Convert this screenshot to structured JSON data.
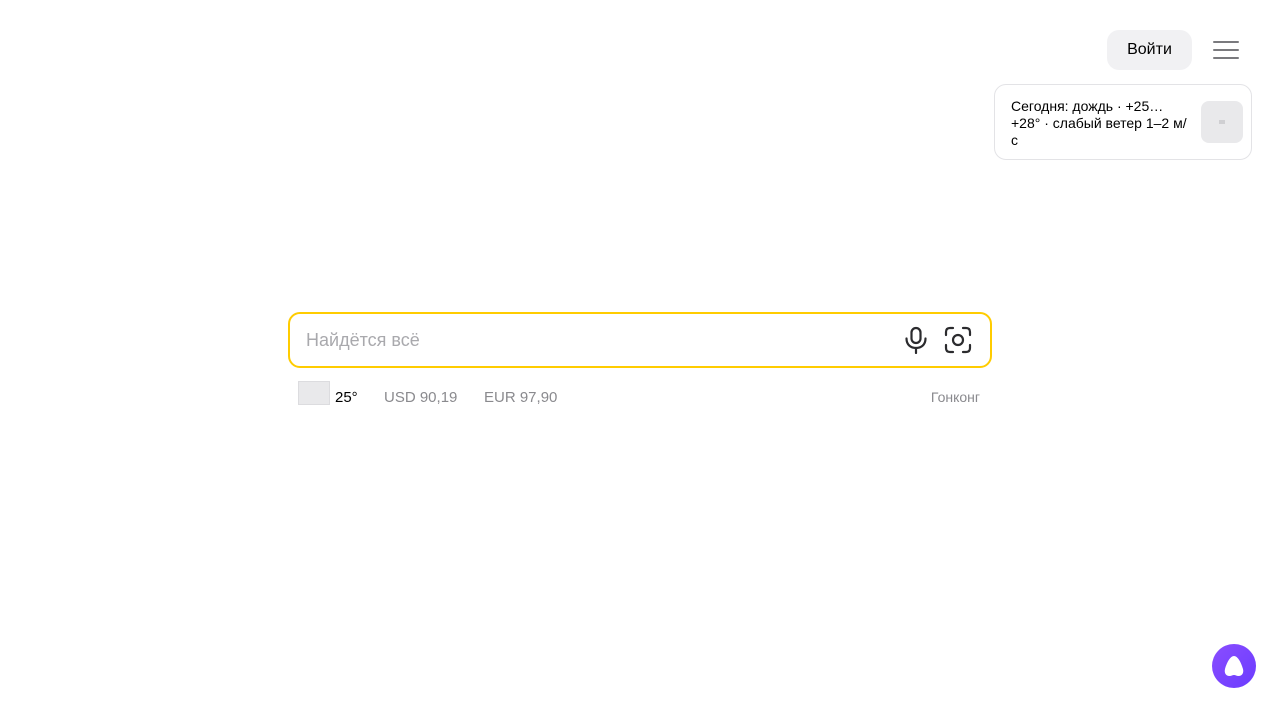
{
  "header": {
    "login_label": "Войти",
    "menu_icon": "hamburger-menu-icon"
  },
  "weather_card": {
    "text": "Сегодня: дождь · +25…+28° · слабый ветер 1–2 м/с",
    "icon": "weather-image"
  },
  "search": {
    "value": "",
    "placeholder": "Найдётся всё",
    "accent_color": "#ffcc00",
    "voice_icon": "microphone-icon",
    "image_search_icon": "camera-icon"
  },
  "informers": {
    "temperature": "25°",
    "usd": "USD 90,19",
    "eur": "EUR 97,90",
    "city": "Гонконг"
  },
  "alice": {
    "icon": "alice-icon",
    "color": "#7a47ff"
  }
}
